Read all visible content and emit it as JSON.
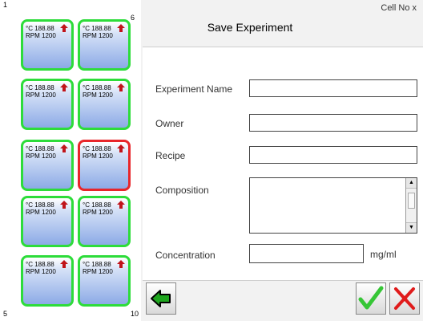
{
  "corner_labels": {
    "top_left": "1",
    "top_right": "6",
    "bottom_left": "5",
    "bottom_right": "10"
  },
  "cells": [
    {
      "temp": "°C 188.88",
      "rpm": "RPM 1200",
      "status": "ok"
    },
    {
      "temp": "°C 188.88",
      "rpm": "RPM 1200",
      "status": "ok"
    },
    {
      "temp": "°C 188.88",
      "rpm": "RPM 1200",
      "status": "ok"
    },
    {
      "temp": "°C 188.88",
      "rpm": "RPM 1200",
      "status": "ok"
    },
    {
      "temp": "°C 188.88",
      "rpm": "RPM 1200",
      "status": "ok"
    },
    {
      "temp": "°C 188.88",
      "rpm": "RPM 1200",
      "status": "alarm"
    },
    {
      "temp": "°C 188.88",
      "rpm": "RPM 1200",
      "status": "ok"
    },
    {
      "temp": "°C 188.88",
      "rpm": "RPM 1200",
      "status": "ok"
    },
    {
      "temp": "°C 188.88",
      "rpm": "RPM 1200",
      "status": "ok"
    },
    {
      "temp": "°C 188.88",
      "rpm": "RPM 1200",
      "status": "ok"
    }
  ],
  "header": {
    "cell_no": "Cell No x",
    "title": "Save Experiment"
  },
  "form": {
    "experiment_name": {
      "label": "Experiment Name",
      "value": ""
    },
    "owner": {
      "label": "Owner",
      "value": ""
    },
    "recipe": {
      "label": "Recipe",
      "value": ""
    },
    "composition": {
      "label": "Composition",
      "value": ""
    },
    "concentration": {
      "label": "Concentration",
      "value": "",
      "unit": "mg/ml"
    }
  },
  "icons": {
    "cell_arrow": "up-arrow-icon",
    "back": "back-arrow-icon",
    "confirm": "checkmark-icon",
    "cancel": "close-icon"
  },
  "colors": {
    "ok_border": "#2ddc3a",
    "alarm_border": "#e8262a",
    "arrow_red": "#c0141a",
    "back_green": "#1ea51e",
    "check_green": "#36c636",
    "cancel_red": "#e01b1b"
  }
}
